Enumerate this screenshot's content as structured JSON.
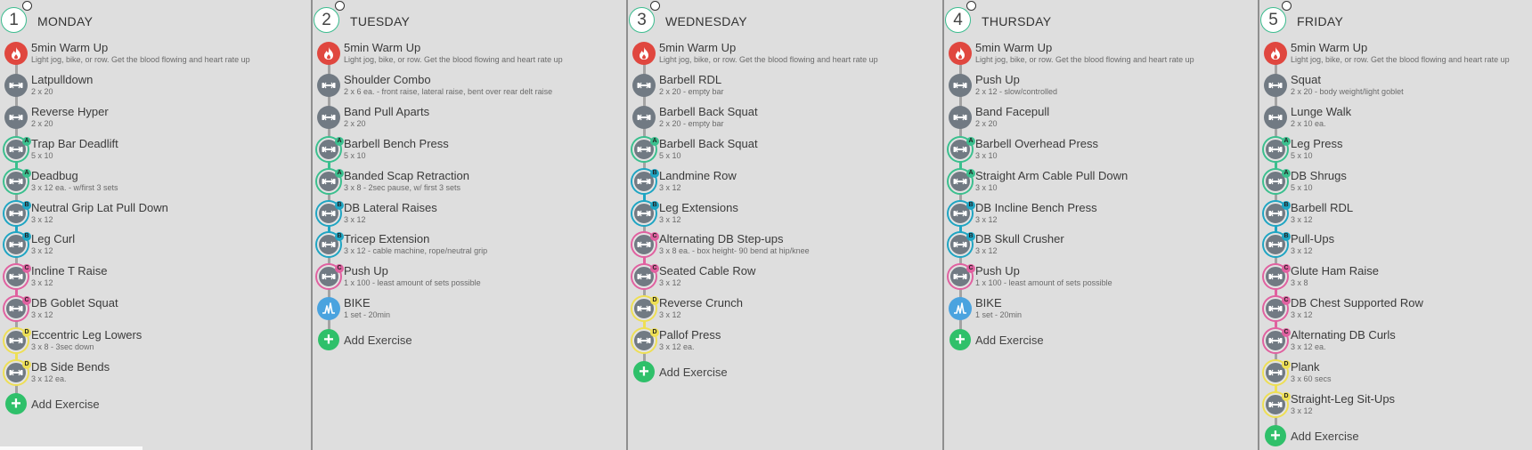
{
  "add_label": "Add Exercise",
  "colors": {
    "warm": "#e0473f",
    "bike": "#4aa3df",
    "std": "#717a83",
    "A": "#3bbf8e",
    "B": "#1fa5c3",
    "C": "#e061a0",
    "D": "#eedf55",
    "add": "#2fc06a"
  },
  "days": [
    {
      "num": "1",
      "name": "MONDAY",
      "exercises": [
        {
          "name": "5min Warm Up",
          "detail": "Light jog, bike, or row. Get the blood flowing and heart rate up",
          "icon": "flame-icon",
          "group": ""
        },
        {
          "name": "Latpulldown",
          "detail": "2 x 20",
          "icon": "dumbbell-icon",
          "group": ""
        },
        {
          "name": "Reverse Hyper",
          "detail": "2 x 20",
          "icon": "dumbbell-icon",
          "group": ""
        },
        {
          "name": "Trap Bar Deadlift",
          "detail": "5 x 10",
          "icon": "dumbbell-icon",
          "group": "A"
        },
        {
          "name": "Deadbug",
          "detail": "3 x 12 ea. - w/first 3 sets",
          "icon": "dumbbell-icon",
          "group": "A"
        },
        {
          "name": "Neutral Grip Lat Pull Down",
          "detail": "3 x 12",
          "icon": "dumbbell-icon",
          "group": "B"
        },
        {
          "name": "Leg Curl",
          "detail": "3 x 12",
          "icon": "dumbbell-icon",
          "group": "B"
        },
        {
          "name": "Incline T Raise",
          "detail": "3 x 12",
          "icon": "dumbbell-icon",
          "group": "C"
        },
        {
          "name": "DB Goblet Squat",
          "detail": "3 x 12",
          "icon": "dumbbell-icon",
          "group": "C"
        },
        {
          "name": "Eccentric Leg Lowers",
          "detail": "3 x 8 - 3sec down",
          "icon": "dumbbell-icon",
          "group": "D"
        },
        {
          "name": "DB Side Bends",
          "detail": "3 x 12 ea.",
          "icon": "dumbbell-icon",
          "group": "D"
        }
      ]
    },
    {
      "num": "2",
      "name": "TUESDAY",
      "exercises": [
        {
          "name": "5min Warm Up",
          "detail": "Light jog, bike, or row. Get the blood flowing and heart rate up",
          "icon": "flame-icon",
          "group": ""
        },
        {
          "name": "Shoulder Combo",
          "detail": "2 x 6 ea. - front raise, lateral raise, bent over rear delt raise",
          "icon": "dumbbell-icon",
          "group": ""
        },
        {
          "name": "Band Pull Aparts",
          "detail": "2 x 20",
          "icon": "dumbbell-icon",
          "group": ""
        },
        {
          "name": "Barbell Bench Press",
          "detail": "5 x 10",
          "icon": "dumbbell-icon",
          "group": "A"
        },
        {
          "name": "Banded Scap Retraction",
          "detail": "3 x 8 - 2sec pause, w/ first 3 sets",
          "icon": "dumbbell-icon",
          "group": "A"
        },
        {
          "name": "DB Lateral Raises",
          "detail": "3 x 12",
          "icon": "dumbbell-icon",
          "group": "B"
        },
        {
          "name": "Tricep Extension",
          "detail": "3 x 12 - cable machine, rope/neutral grip",
          "icon": "dumbbell-icon",
          "group": "B"
        },
        {
          "name": "Push Up",
          "detail": "1 x 100 - least amount of sets possible",
          "icon": "dumbbell-icon",
          "group": "C"
        },
        {
          "name": "BIKE",
          "detail": "1 set - 20min",
          "icon": "pulse-icon",
          "group": ""
        }
      ]
    },
    {
      "num": "3",
      "name": "WEDNESDAY",
      "exercises": [
        {
          "name": "5min Warm Up",
          "detail": "Light jog, bike, or row. Get the blood flowing and heart rate up",
          "icon": "flame-icon",
          "group": ""
        },
        {
          "name": "Barbell RDL",
          "detail": "2 x 20 - empty bar",
          "icon": "dumbbell-icon",
          "group": ""
        },
        {
          "name": "Barbell Back Squat",
          "detail": "2 x 20 - empty bar",
          "icon": "dumbbell-icon",
          "group": ""
        },
        {
          "name": "Barbell Back Squat",
          "detail": "5 x 10",
          "icon": "dumbbell-icon",
          "group": "A"
        },
        {
          "name": "Landmine Row",
          "detail": "3 x 12",
          "icon": "dumbbell-icon",
          "group": "B"
        },
        {
          "name": "Leg Extensions",
          "detail": "3 x 12",
          "icon": "dumbbell-icon",
          "group": "B"
        },
        {
          "name": "Alternating DB Step-ups",
          "detail": "3 x 8 ea. - box height- 90 bend at hip/knee",
          "icon": "dumbbell-icon",
          "group": "C"
        },
        {
          "name": "Seated Cable Row",
          "detail": "3 x 12",
          "icon": "dumbbell-icon",
          "group": "C"
        },
        {
          "name": "Reverse Crunch",
          "detail": "3 x 12",
          "icon": "dumbbell-icon",
          "group": "D"
        },
        {
          "name": "Pallof Press",
          "detail": "3 x 12 ea.",
          "icon": "dumbbell-icon",
          "group": "D"
        }
      ]
    },
    {
      "num": "4",
      "name": "THURSDAY",
      "exercises": [
        {
          "name": "5min Warm Up",
          "detail": "Light jog, bike, or row. Get the blood flowing and heart rate up",
          "icon": "flame-icon",
          "group": ""
        },
        {
          "name": "Push Up",
          "detail": "2 x 12 - slow/controlled",
          "icon": "dumbbell-icon",
          "group": ""
        },
        {
          "name": "Band Facepull",
          "detail": "2 x 20",
          "icon": "dumbbell-icon",
          "group": ""
        },
        {
          "name": "Barbell Overhead Press",
          "detail": "3 x 10",
          "icon": "dumbbell-icon",
          "group": "A"
        },
        {
          "name": "Straight Arm Cable Pull Down",
          "detail": "3 x 10",
          "icon": "dumbbell-icon",
          "group": "A"
        },
        {
          "name": "DB Incline Bench Press",
          "detail": "3 x 12",
          "icon": "dumbbell-icon",
          "group": "B"
        },
        {
          "name": "DB Skull Crusher",
          "detail": "3 x 12",
          "icon": "dumbbell-icon",
          "group": "B"
        },
        {
          "name": "Push Up",
          "detail": "1 x 100 - least amount of sets possible",
          "icon": "dumbbell-icon",
          "group": "C"
        },
        {
          "name": "BIKE",
          "detail": "1 set - 20min",
          "icon": "pulse-icon",
          "group": ""
        }
      ]
    },
    {
      "num": "5",
      "name": "FRIDAY",
      "exercises": [
        {
          "name": "5min Warm Up",
          "detail": "Light jog, bike, or row. Get the blood flowing and heart rate up",
          "icon": "flame-icon",
          "group": ""
        },
        {
          "name": "Squat",
          "detail": "2 x 20 - body weight/light goblet",
          "icon": "dumbbell-icon",
          "group": ""
        },
        {
          "name": "Lunge Walk",
          "detail": "2 x 10 ea.",
          "icon": "dumbbell-icon",
          "group": ""
        },
        {
          "name": "Leg Press",
          "detail": "5 x 10",
          "icon": "dumbbell-icon",
          "group": "A"
        },
        {
          "name": "DB Shrugs",
          "detail": "5 x 10",
          "icon": "dumbbell-icon",
          "group": "A"
        },
        {
          "name": "Barbell RDL",
          "detail": "3 x 12",
          "icon": "dumbbell-icon",
          "group": "B"
        },
        {
          "name": "Pull-Ups",
          "detail": "3 x 12",
          "icon": "dumbbell-icon",
          "group": "B"
        },
        {
          "name": "Glute Ham Raise",
          "detail": "3 x 8",
          "icon": "dumbbell-icon",
          "group": "C"
        },
        {
          "name": "DB Chest Supported Row",
          "detail": "3 x 12",
          "icon": "dumbbell-icon",
          "group": "C"
        },
        {
          "name": "Alternating DB Curls",
          "detail": "3 x 12 ea.",
          "icon": "dumbbell-icon",
          "group": "C"
        },
        {
          "name": "Plank",
          "detail": "3 x 60 secs",
          "icon": "dumbbell-icon",
          "group": "D"
        },
        {
          "name": "Straight-Leg Sit-Ups",
          "detail": "3 x 12",
          "icon": "dumbbell-icon",
          "group": "D"
        }
      ]
    }
  ]
}
